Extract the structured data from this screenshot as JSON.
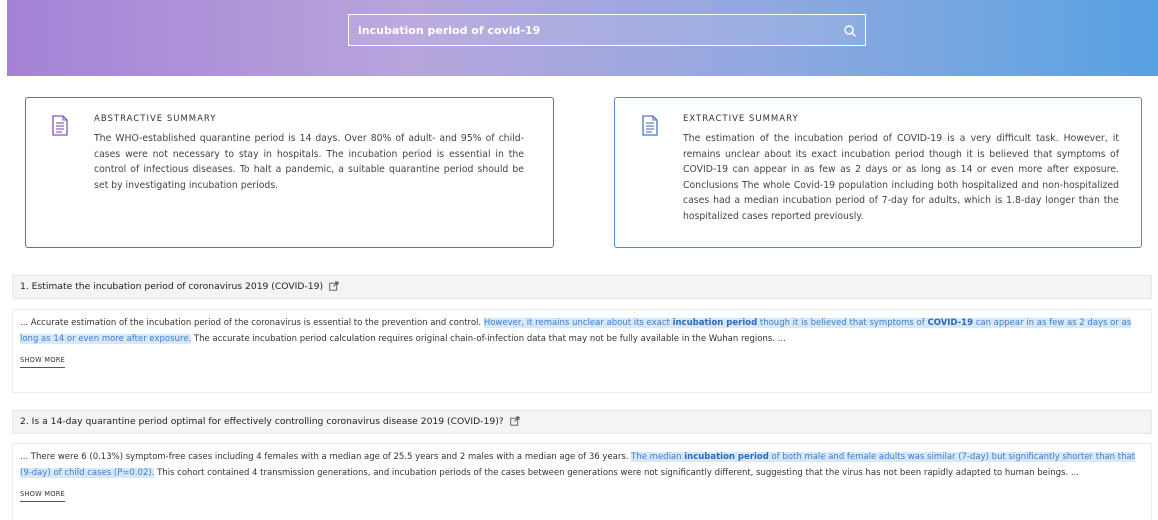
{
  "search": {
    "query": "incubation period of covid-19",
    "icon": "search-icon"
  },
  "summaries": {
    "abstractive": {
      "heading": "ABSTRACTIVE SUMMARY",
      "icon": "document-icon",
      "accent": "#8a55c7",
      "text": "The WHO-established quarantine period is 14 days. Over 80% of adult- and 95% of child-cases were not necessary to stay in hospitals. The incubation period is essential in the control of infectious diseases. To halt a pandemic, a suitable quarantine period should be set by investigating incubation periods."
    },
    "extractive": {
      "heading": "EXTRACTIVE SUMMARY",
      "icon": "document-icon",
      "accent": "#5a86cf",
      "text": "The estimation of the incubation period of COVID-19 is a very difficult task. However, it remains unclear about its exact incubation period though it is believed that symptoms of COVID-19 can appear in as few as 2 days or as long as 14 or even more after exposure. Conclusions The whole Covid-19 population including both hospitalized and non-hospitalized cases had a median incubation period of 7-day for adults, which is 1.8-day longer than the hospitalized cases reported previously."
    }
  },
  "results": [
    {
      "title": "1. Estimate the incubation period of coronavirus 2019 (COVID-19)",
      "link_icon": "external-link-icon",
      "snippet": {
        "before": "... Accurate estimation of the incubation period of the coronavirus is essential to the prevention and control. ",
        "hl_1": "However, it remains unclear about its exact ",
        "hl_bold_1": "incubation period",
        "hl_2": " though it is believed that symptoms of ",
        "hl_bold_2": "COVID-19",
        "hl_3": " can appear in as few as 2 days or as long as 14 or even more after exposure.",
        "after": " The accurate incubation period calculation requires original chain-of-infection data that may not be fully available in the Wuhan regions. ..."
      },
      "show_more": "SHOW MORE"
    },
    {
      "title": "2. Is a 14-day quarantine period optimal for effectively controlling coronavirus disease 2019 (COVID-19)?",
      "link_icon": "external-link-icon",
      "snippet": {
        "before": "... There were 6 (0.13%) symptom-free cases including 4 females with a median age of 25.5 years and 2 males with a median age of 36 years. ",
        "hl_1": "The median ",
        "hl_bold_1": "incubation period",
        "hl_2": " of both male and female adults was similar (7-day) but significantly shorter than that (9-day) of child cases (P=0.02).",
        "after": " This cohort contained 4 transmission generations, and incubation periods of the cases between generations were not significantly different, suggesting that the virus has not been rapidly adapted to human beings. ..."
      },
      "show_more": "SHOW MORE"
    }
  ]
}
